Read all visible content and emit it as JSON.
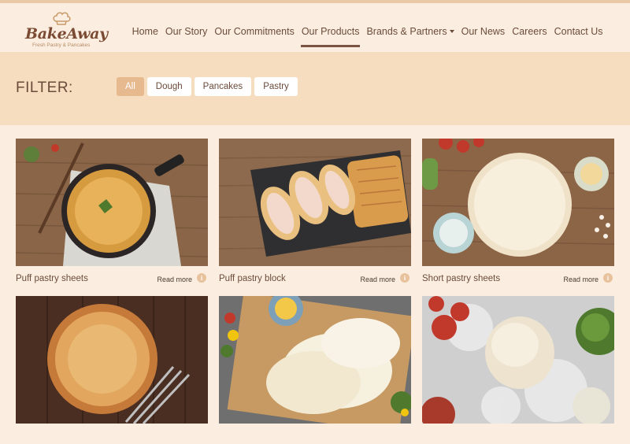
{
  "brand": {
    "name": "BakeAway",
    "tagline": "Fresh Pastry & Pancakes"
  },
  "nav": [
    {
      "label": "Home"
    },
    {
      "label": "Our Story"
    },
    {
      "label": "Our Commitments"
    },
    {
      "label": "Our Products",
      "active": true
    },
    {
      "label": "Brands & Partners",
      "dropdown": true
    },
    {
      "label": "Our News"
    },
    {
      "label": "Careers"
    },
    {
      "label": "Contact Us"
    }
  ],
  "filter": {
    "label": "FILTER:",
    "chips": [
      "All",
      "Dough",
      "Pancakes",
      "Pastry"
    ],
    "selected": "All"
  },
  "products": [
    {
      "title": "Puff pastry sheets",
      "more": "Read more",
      "info": "i"
    },
    {
      "title": "Puff pastry block",
      "more": "Read more",
      "info": "i"
    },
    {
      "title": "Short pastry sheets",
      "more": "Read more",
      "info": "i"
    },
    {
      "title": "",
      "more": "",
      "info": ""
    },
    {
      "title": "",
      "more": "",
      "info": ""
    },
    {
      "title": "",
      "more": "",
      "info": ""
    }
  ],
  "colors": {
    "accent": "#e6b98f",
    "background": "#fbeee0",
    "band": "#f7ddbf",
    "text": "#6b4b3a"
  }
}
